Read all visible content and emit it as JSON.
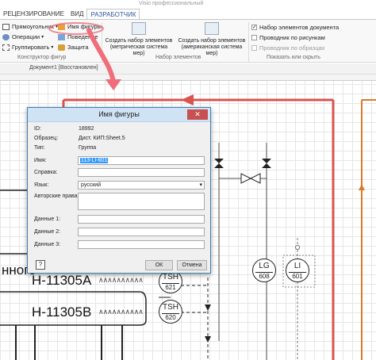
{
  "app": {
    "title": "Visio профессиональный",
    "tabs": [
      "РЕЦЕНЗИРОВАНИЕ",
      "ВИД",
      "РАЗРАБОТЧИК"
    ],
    "active_tab": "РАЗРАБОТЧИК"
  },
  "ribbon": {
    "shape_designer": {
      "rectangle": "Прямоугольник",
      "operations": "Операции",
      "group": "Группировать",
      "shape_name": "Имя фигуры",
      "behavior": "Поведение",
      "protection": "Защита",
      "label": "Конструктор фигур"
    },
    "stencils": {
      "create_metric": "Создать набор элементов (метрическая система мер)",
      "create_us": "Создать набор элементов (американская система мер)",
      "label": "Набор элементов"
    },
    "show_hide": {
      "doc_stencil": "Набор элементов документа",
      "drawing_explorer": "Проводник по рисункам",
      "master_explorer": "Проводник по образцах",
      "label": "Показать или скрыть"
    }
  },
  "document_tab": "Документ1 [Восстановлен]",
  "dialog": {
    "title": "Имя фигуры",
    "id_label": "ID:",
    "id_value": "18992",
    "master_label": "Образец:",
    "master_value": "Дист. КИП:Sheet.5",
    "type_label": "Тип:",
    "type_value": "Группа",
    "name_label": "Имя:",
    "name_value": "113-LI-601",
    "help_label": "Справка:",
    "language_label": "Язык:",
    "language_value": "русский",
    "copyright_label": "Авторские права:",
    "data1_label": "Данные 1:",
    "data2_label": "Данные 2:",
    "data3_label": "Данные 3:",
    "ok": "ОК",
    "cancel": "Отмена",
    "close": "✕",
    "help_btn": "?"
  },
  "diagram": {
    "tag1": "H-11305A",
    "tag2": "H-11305B",
    "partial_text": "нного",
    "instruments": [
      {
        "top": "LG",
        "bottom": "608"
      },
      {
        "top": "LI",
        "bottom": "601"
      },
      {
        "top": "TSH",
        "bottom": "621"
      },
      {
        "top": "TSH",
        "bottom": "620"
      }
    ]
  },
  "colors": {
    "accent": "#2b579a",
    "annotation_arrow": "#f06d7a",
    "pipe_red": "#d9534f",
    "pipe_orange": "#d97a2b"
  }
}
